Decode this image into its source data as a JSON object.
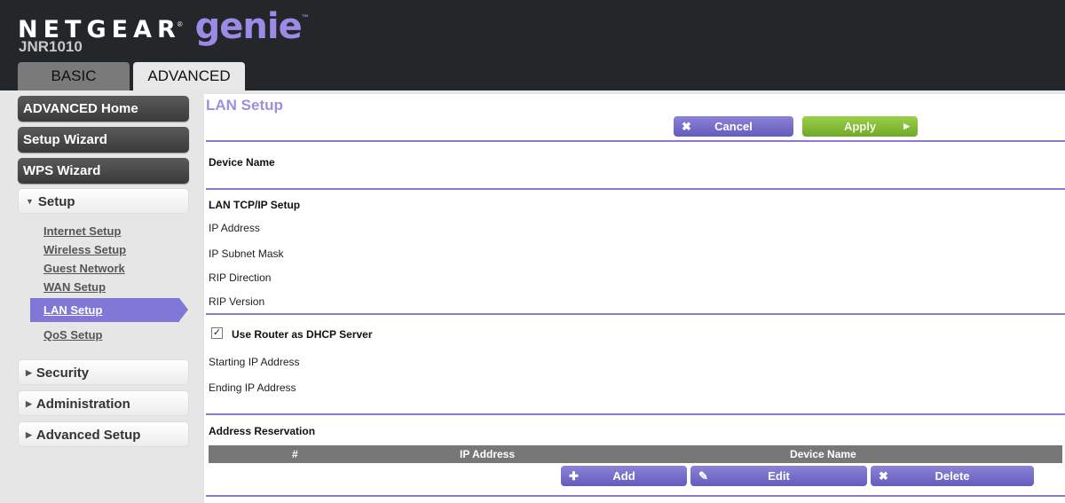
{
  "header": {
    "brand": "NETGEAR",
    "brand_mark": "®",
    "product": "genie",
    "product_mark": "™",
    "model": "JNR1010",
    "tabs": [
      {
        "label": "BASIC",
        "active": false
      },
      {
        "label": "ADVANCED",
        "active": true
      }
    ]
  },
  "sidebar": {
    "main_buttons": [
      {
        "label": "ADVANCED Home"
      },
      {
        "label": "Setup Wizard"
      },
      {
        "label": "WPS Wizard"
      }
    ],
    "setup": {
      "label": "Setup",
      "expanded": true,
      "items": [
        {
          "label": "Internet Setup"
        },
        {
          "label": "Wireless Setup"
        },
        {
          "label": "Guest Network"
        },
        {
          "label": "WAN Setup"
        },
        {
          "label": "LAN Setup",
          "active": true
        },
        {
          "label": "QoS Setup"
        }
      ]
    },
    "collapsed_sections": [
      {
        "label": "Security"
      },
      {
        "label": "Administration"
      },
      {
        "label": "Advanced Setup"
      }
    ]
  },
  "main": {
    "title": "LAN Setup",
    "actions": {
      "cancel_label": "Cancel",
      "apply_label": "Apply"
    },
    "device_name_label": "Device Name",
    "tcpip": {
      "heading": "LAN TCP/IP Setup",
      "fields": [
        "IP Address",
        "IP Subnet Mask",
        "RIP Direction",
        "RIP Version"
      ]
    },
    "dhcp": {
      "checkbox_label": "Use Router as DHCP Server",
      "checked": true,
      "fields": [
        "Starting IP Address",
        "Ending IP Address"
      ]
    },
    "reservation": {
      "heading": "Address Reservation",
      "columns": [
        "#",
        "IP Address",
        "Device Name"
      ],
      "rows": [],
      "buttons": {
        "add": "Add",
        "edit": "Edit",
        "delete": "Delete"
      }
    }
  },
  "icons": {
    "check": "✓",
    "close": "✖",
    "plus": "✚",
    "pencil": "✎",
    "play": "▶",
    "caret_down": "▼",
    "caret_right": "▶"
  },
  "colors": {
    "header_bg": "#23272a",
    "accent_purple": "#8077d6",
    "genie_purple": "#9c8ae6",
    "apply_green": "#86bd3a",
    "divider": "#8e78d2"
  }
}
